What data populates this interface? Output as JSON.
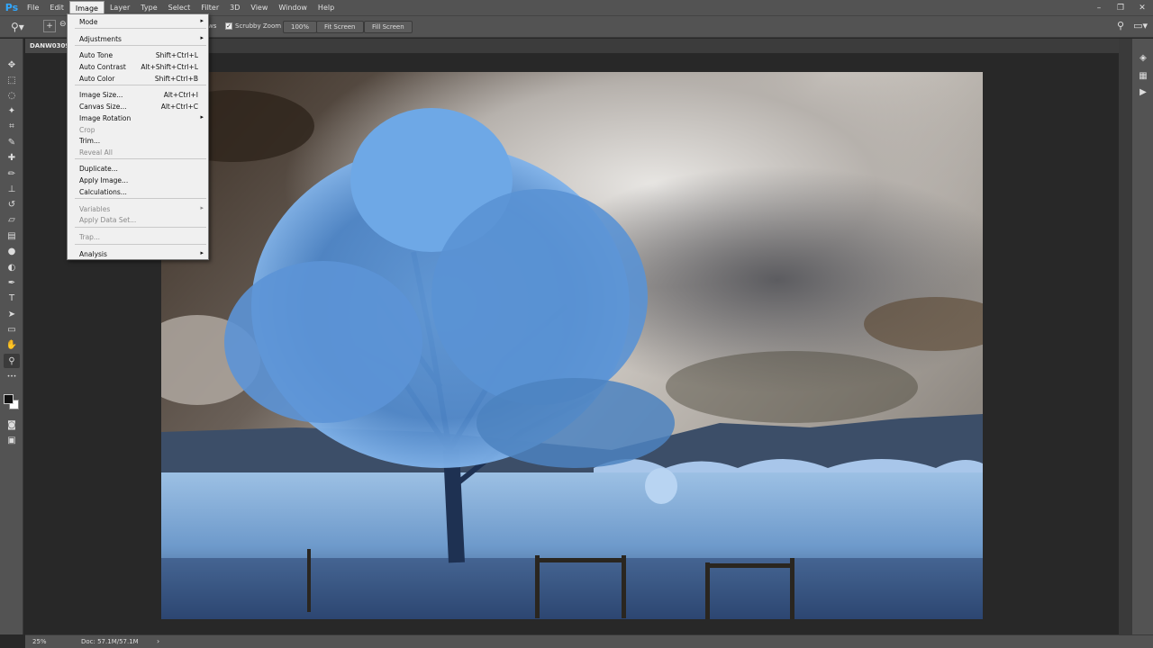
{
  "app": {
    "logo": "Ps"
  },
  "menubar": {
    "items": [
      "File",
      "Edit",
      "Image",
      "Layer",
      "Type",
      "Select",
      "Filter",
      "3D",
      "View",
      "Window",
      "Help"
    ],
    "active": "Image"
  },
  "window_controls": {
    "minimize": "–",
    "restore": "❐",
    "close": "✕"
  },
  "options": {
    "tool_icon": "zoom-icon",
    "partial_label": "ws",
    "scrubby_zoom": {
      "label": "Scrubby Zoom",
      "checked": true
    },
    "zoom_100": "100%",
    "fit_screen": "Fit Screen",
    "fill_screen": "Fill Screen"
  },
  "document": {
    "tab_label": "DANW0309"
  },
  "image_menu": {
    "items": [
      {
        "label": "Mode",
        "shortcut": "",
        "submenu": true,
        "disabled": false
      },
      {
        "sep": true
      },
      {
        "label": "Adjustments",
        "shortcut": "",
        "submenu": true,
        "disabled": false
      },
      {
        "sep": true
      },
      {
        "label": "Auto Tone",
        "shortcut": "Shift+Ctrl+L",
        "submenu": false,
        "disabled": false
      },
      {
        "label": "Auto Contrast",
        "shortcut": "Alt+Shift+Ctrl+L",
        "submenu": false,
        "disabled": false
      },
      {
        "label": "Auto Color",
        "shortcut": "Shift+Ctrl+B",
        "submenu": false,
        "disabled": false
      },
      {
        "sep": true
      },
      {
        "label": "Image Size...",
        "shortcut": "Alt+Ctrl+I",
        "submenu": false,
        "disabled": false
      },
      {
        "label": "Canvas Size...",
        "shortcut": "Alt+Ctrl+C",
        "submenu": false,
        "disabled": false
      },
      {
        "label": "Image Rotation",
        "shortcut": "",
        "submenu": true,
        "disabled": false
      },
      {
        "label": "Crop",
        "shortcut": "",
        "submenu": false,
        "disabled": true
      },
      {
        "label": "Trim...",
        "shortcut": "",
        "submenu": false,
        "disabled": false
      },
      {
        "label": "Reveal All",
        "shortcut": "",
        "submenu": false,
        "disabled": true
      },
      {
        "sep": true
      },
      {
        "label": "Duplicate...",
        "shortcut": "",
        "submenu": false,
        "disabled": false
      },
      {
        "label": "Apply Image...",
        "shortcut": "",
        "submenu": false,
        "disabled": false
      },
      {
        "label": "Calculations...",
        "shortcut": "",
        "submenu": false,
        "disabled": false
      },
      {
        "sep": true
      },
      {
        "label": "Variables",
        "shortcut": "",
        "submenu": true,
        "disabled": true
      },
      {
        "label": "Apply Data Set...",
        "shortcut": "",
        "submenu": false,
        "disabled": true
      },
      {
        "sep": true
      },
      {
        "label": "Trap...",
        "shortcut": "",
        "submenu": false,
        "disabled": true
      },
      {
        "sep": true
      },
      {
        "label": "Analysis",
        "shortcut": "",
        "submenu": true,
        "disabled": false
      }
    ]
  },
  "toolbar": {
    "tools": [
      {
        "name": "move-tool-icon",
        "glyph": "✥"
      },
      {
        "name": "marquee-tool-icon",
        "glyph": "⬚"
      },
      {
        "name": "lasso-tool-icon",
        "glyph": "◌"
      },
      {
        "name": "magic-wand-tool-icon",
        "glyph": "✦"
      },
      {
        "name": "crop-tool-icon",
        "glyph": "⌗"
      },
      {
        "name": "eyedropper-tool-icon",
        "glyph": "✎"
      },
      {
        "name": "healing-brush-tool-icon",
        "glyph": "✚"
      },
      {
        "name": "brush-tool-icon",
        "glyph": "✏"
      },
      {
        "name": "clone-stamp-tool-icon",
        "glyph": "⊥"
      },
      {
        "name": "history-brush-tool-icon",
        "glyph": "↺"
      },
      {
        "name": "eraser-tool-icon",
        "glyph": "▱"
      },
      {
        "name": "gradient-tool-icon",
        "glyph": "▤"
      },
      {
        "name": "blur-tool-icon",
        "glyph": "●"
      },
      {
        "name": "dodge-tool-icon",
        "glyph": "◐"
      },
      {
        "name": "pen-tool-icon",
        "glyph": "✒"
      },
      {
        "name": "type-tool-icon",
        "glyph": "T"
      },
      {
        "name": "path-selection-tool-icon",
        "glyph": "➤"
      },
      {
        "name": "rectangle-tool-icon",
        "glyph": "▭"
      },
      {
        "name": "hand-tool-icon",
        "glyph": "✋"
      },
      {
        "name": "zoom-tool-icon",
        "glyph": "⚲"
      },
      {
        "name": "more-tools-icon",
        "glyph": "•••"
      }
    ],
    "quick_mask": "quick-mask-icon",
    "screen_mode": "screen-mode-icon"
  },
  "right_panel": {
    "icons": [
      "layers-panel-icon",
      "channels-panel-icon",
      "play-actions-icon"
    ]
  },
  "status": {
    "zoom": "25%",
    "doc": "Doc: 57.1M/57.1M",
    "arrow": "›"
  }
}
